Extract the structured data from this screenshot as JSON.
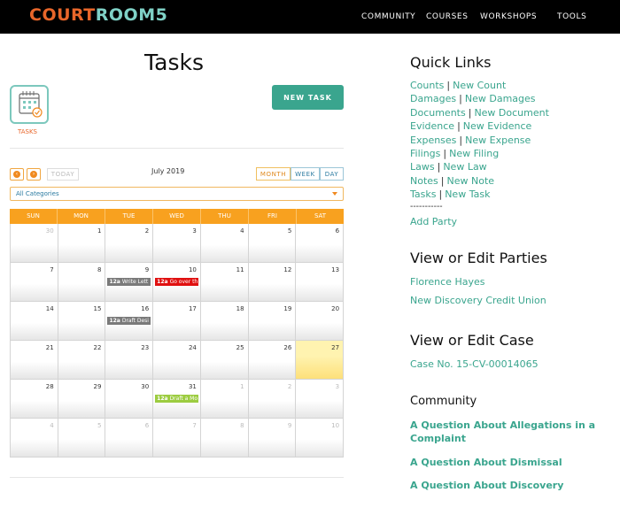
{
  "brand": {
    "part1": "COURT",
    "part2": "ROOM5"
  },
  "nav": {
    "community": "COMMUNITY",
    "courses": "COURSES",
    "workshops": "WORKSHOPS",
    "tools": "TOOLS"
  },
  "page": {
    "title": "Tasks",
    "icon_label": "TASKS",
    "new_task": "NEW TASK"
  },
  "calendar": {
    "today_label": "TODAY",
    "month_label": "July 2019",
    "view_month": "MONTH",
    "view_week": "WEEK",
    "view_day": "DAY",
    "category": "All Categories",
    "weekdays": [
      "SUN",
      "MON",
      "TUE",
      "WED",
      "THU",
      "FRI",
      "SAT"
    ],
    "weeks": [
      [
        {
          "n": "30",
          "o": true
        },
        {
          "n": "1"
        },
        {
          "n": "2"
        },
        {
          "n": "3"
        },
        {
          "n": "4"
        },
        {
          "n": "5"
        },
        {
          "n": "6"
        }
      ],
      [
        {
          "n": "7"
        },
        {
          "n": "8"
        },
        {
          "n": "9",
          "evt": {
            "time": "12a",
            "title": "Write Lett",
            "color": "gray"
          }
        },
        {
          "n": "10",
          "evt": {
            "time": "12a",
            "title": "Go over th",
            "color": "red"
          }
        },
        {
          "n": "11"
        },
        {
          "n": "12"
        },
        {
          "n": "13"
        }
      ],
      [
        {
          "n": "14"
        },
        {
          "n": "15"
        },
        {
          "n": "16",
          "evt": {
            "time": "12a",
            "title": "Draft Desi",
            "color": "gray"
          }
        },
        {
          "n": "17"
        },
        {
          "n": "18"
        },
        {
          "n": "19"
        },
        {
          "n": "20"
        }
      ],
      [
        {
          "n": "21"
        },
        {
          "n": "22"
        },
        {
          "n": "23"
        },
        {
          "n": "24"
        },
        {
          "n": "25"
        },
        {
          "n": "26"
        },
        {
          "n": "27",
          "today": true
        }
      ],
      [
        {
          "n": "28"
        },
        {
          "n": "29"
        },
        {
          "n": "30"
        },
        {
          "n": "31",
          "evt": {
            "time": "12a",
            "title": "Draft a Mo",
            "color": "green"
          }
        },
        {
          "n": "1",
          "o": true
        },
        {
          "n": "2",
          "o": true
        },
        {
          "n": "3",
          "o": true
        }
      ],
      [
        {
          "n": "4",
          "o": true
        },
        {
          "n": "5",
          "o": true
        },
        {
          "n": "6",
          "o": true
        },
        {
          "n": "7",
          "o": true
        },
        {
          "n": "8",
          "o": true
        },
        {
          "n": "9",
          "o": true
        },
        {
          "n": "10",
          "o": true
        }
      ]
    ]
  },
  "quick_links": {
    "heading": "Quick Links",
    "rows": [
      [
        "Counts",
        "New Count"
      ],
      [
        "Damages",
        "New Damages"
      ],
      [
        "Documents",
        "New Document"
      ],
      [
        "Evidence",
        "New Evidence"
      ],
      [
        "Expenses",
        "New Expense"
      ],
      [
        "Filings",
        "New Filing"
      ],
      [
        "Laws",
        "New Law"
      ],
      [
        "Notes",
        "New Note"
      ],
      [
        "Tasks",
        "New Task"
      ]
    ],
    "divider": "-----------",
    "add_party": "Add Party"
  },
  "parties": {
    "heading": "View or Edit Parties",
    "items": [
      "Florence Hayes",
      "New Discovery Credit Union"
    ]
  },
  "case": {
    "heading": "View or Edit Case",
    "number": "Case No. 15-CV-00014065"
  },
  "community": {
    "heading": "Community",
    "items": [
      "A Question About Allegations in a Complaint",
      "A Question About Dismissal",
      "A Question About Discovery"
    ]
  }
}
